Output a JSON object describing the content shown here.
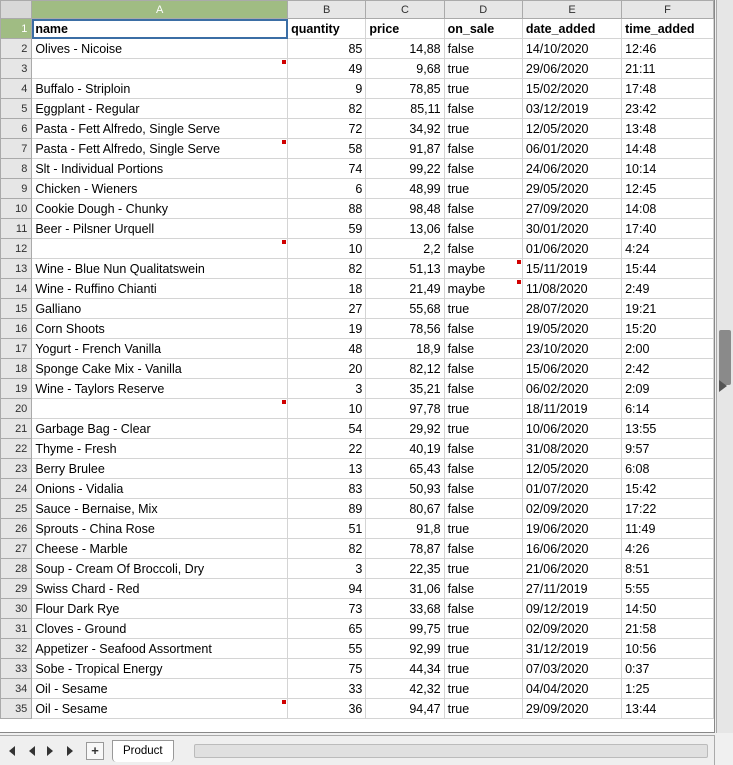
{
  "columns": [
    "A",
    "B",
    "C",
    "D",
    "E",
    "F"
  ],
  "selected_column": "A",
  "selected_row": 1,
  "headers": {
    "name": "name",
    "quantity": "quantity",
    "price": "price",
    "on_sale": "on_sale",
    "date_added": "date_added",
    "time_added": "time_added"
  },
  "rows": [
    {
      "r": 2,
      "name": "Olives - Nicoise",
      "quantity": "85",
      "price": "14,88",
      "on_sale": "false",
      "date_added": "14/10/2020",
      "time_added": "12:46"
    },
    {
      "r": 3,
      "name": "",
      "quantity": "49",
      "price": "9,68",
      "on_sale": "true",
      "date_added": "29/06/2020",
      "time_added": "21:11",
      "mark_name": true
    },
    {
      "r": 4,
      "name": "Buffalo - Striploin",
      "quantity": "9",
      "price": "78,85",
      "on_sale": "true",
      "date_added": "15/02/2020",
      "time_added": "17:48"
    },
    {
      "r": 5,
      "name": "Eggplant - Regular",
      "quantity": "82",
      "price": "85,11",
      "on_sale": "false",
      "date_added": "03/12/2019",
      "time_added": "23:42"
    },
    {
      "r": 6,
      "name": "Pasta - Fett Alfredo, Single Serve",
      "quantity": "72",
      "price": "34,92",
      "on_sale": "true",
      "date_added": "12/05/2020",
      "time_added": "13:48"
    },
    {
      "r": 7,
      "name": "Pasta - Fett Alfredo, Single Serve",
      "quantity": "58",
      "price": "91,87",
      "on_sale": "false",
      "date_added": "06/01/2020",
      "time_added": "14:48",
      "mark_name": true
    },
    {
      "r": 8,
      "name": "Slt - Individual Portions",
      "quantity": "74",
      "price": "99,22",
      "on_sale": "false",
      "date_added": "24/06/2020",
      "time_added": "10:14"
    },
    {
      "r": 9,
      "name": "Chicken - Wieners",
      "quantity": "6",
      "price": "48,99",
      "on_sale": "true",
      "date_added": "29/05/2020",
      "time_added": "12:45"
    },
    {
      "r": 10,
      "name": "Cookie Dough - Chunky",
      "quantity": "88",
      "price": "98,48",
      "on_sale": "false",
      "date_added": "27/09/2020",
      "time_added": "14:08"
    },
    {
      "r": 11,
      "name": "Beer - Pilsner Urquell",
      "quantity": "59",
      "price": "13,06",
      "on_sale": "false",
      "date_added": "30/01/2020",
      "time_added": "17:40"
    },
    {
      "r": 12,
      "name": "",
      "quantity": "10",
      "price": "2,2",
      "on_sale": "false",
      "date_added": "01/06/2020",
      "time_added": "4:24",
      "mark_name": true
    },
    {
      "r": 13,
      "name": "Wine - Blue Nun Qualitatswein",
      "quantity": "82",
      "price": "51,13",
      "on_sale": "maybe",
      "date_added": "15/11/2019",
      "time_added": "15:44",
      "mark_onsale": true
    },
    {
      "r": 14,
      "name": "Wine - Ruffino Chianti",
      "quantity": "18",
      "price": "21,49",
      "on_sale": "maybe",
      "date_added": "11/08/2020",
      "time_added": "2:49",
      "mark_onsale": true
    },
    {
      "r": 15,
      "name": "Galliano",
      "quantity": "27",
      "price": "55,68",
      "on_sale": "true",
      "date_added": "28/07/2020",
      "time_added": "19:21"
    },
    {
      "r": 16,
      "name": "Corn Shoots",
      "quantity": "19",
      "price": "78,56",
      "on_sale": "false",
      "date_added": "19/05/2020",
      "time_added": "15:20"
    },
    {
      "r": 17,
      "name": "Yogurt - French Vanilla",
      "quantity": "48",
      "price": "18,9",
      "on_sale": "false",
      "date_added": "23/10/2020",
      "time_added": "2:00"
    },
    {
      "r": 18,
      "name": "Sponge Cake Mix - Vanilla",
      "quantity": "20",
      "price": "82,12",
      "on_sale": "false",
      "date_added": "15/06/2020",
      "time_added": "2:42"
    },
    {
      "r": 19,
      "name": "Wine - Taylors Reserve",
      "quantity": "3",
      "price": "35,21",
      "on_sale": "false",
      "date_added": "06/02/2020",
      "time_added": "2:09"
    },
    {
      "r": 20,
      "name": "",
      "quantity": "10",
      "price": "97,78",
      "on_sale": "true",
      "date_added": "18/11/2019",
      "time_added": "6:14",
      "mark_name": true
    },
    {
      "r": 21,
      "name": "Garbage Bag - Clear",
      "quantity": "54",
      "price": "29,92",
      "on_sale": "true",
      "date_added": "10/06/2020",
      "time_added": "13:55"
    },
    {
      "r": 22,
      "name": "Thyme - Fresh",
      "quantity": "22",
      "price": "40,19",
      "on_sale": "false",
      "date_added": "31/08/2020",
      "time_added": "9:57"
    },
    {
      "r": 23,
      "name": "Berry Brulee",
      "quantity": "13",
      "price": "65,43",
      "on_sale": "false",
      "date_added": "12/05/2020",
      "time_added": "6:08"
    },
    {
      "r": 24,
      "name": "Onions - Vidalia",
      "quantity": "83",
      "price": "50,93",
      "on_sale": "false",
      "date_added": "01/07/2020",
      "time_added": "15:42"
    },
    {
      "r": 25,
      "name": "Sauce - Bernaise, Mix",
      "quantity": "89",
      "price": "80,67",
      "on_sale": "false",
      "date_added": "02/09/2020",
      "time_added": "17:22"
    },
    {
      "r": 26,
      "name": "Sprouts - China Rose",
      "quantity": "51",
      "price": "91,8",
      "on_sale": "true",
      "date_added": "19/06/2020",
      "time_added": "11:49"
    },
    {
      "r": 27,
      "name": "Cheese - Marble",
      "quantity": "82",
      "price": "78,87",
      "on_sale": "false",
      "date_added": "16/06/2020",
      "time_added": "4:26"
    },
    {
      "r": 28,
      "name": "Soup - Cream Of Broccoli, Dry",
      "quantity": "3",
      "price": "22,35",
      "on_sale": "true",
      "date_added": "21/06/2020",
      "time_added": "8:51"
    },
    {
      "r": 29,
      "name": "Swiss Chard - Red",
      "quantity": "94",
      "price": "31,06",
      "on_sale": "false",
      "date_added": "27/11/2019",
      "time_added": "5:55"
    },
    {
      "r": 30,
      "name": "Flour Dark Rye",
      "quantity": "73",
      "price": "33,68",
      "on_sale": "false",
      "date_added": "09/12/2019",
      "time_added": "14:50"
    },
    {
      "r": 31,
      "name": "Cloves - Ground",
      "quantity": "65",
      "price": "99,75",
      "on_sale": "true",
      "date_added": "02/09/2020",
      "time_added": "21:58"
    },
    {
      "r": 32,
      "name": "Appetizer - Seafood Assortment",
      "quantity": "55",
      "price": "92,99",
      "on_sale": "true",
      "date_added": "31/12/2019",
      "time_added": "10:56"
    },
    {
      "r": 33,
      "name": "Sobe - Tropical Energy",
      "quantity": "75",
      "price": "44,34",
      "on_sale": "true",
      "date_added": "07/03/2020",
      "time_added": "0:37"
    },
    {
      "r": 34,
      "name": "Oil - Sesame",
      "quantity": "33",
      "price": "42,32",
      "on_sale": "true",
      "date_added": "04/04/2020",
      "time_added": "1:25"
    },
    {
      "r": 35,
      "name": "Oil - Sesame",
      "quantity": "36",
      "price": "94,47",
      "on_sale": "true",
      "date_added": "29/09/2020",
      "time_added": "13:44",
      "mark_name": true
    }
  ],
  "sheet_tab": {
    "name": "Product"
  },
  "tabnav": {
    "add_label": "+"
  }
}
